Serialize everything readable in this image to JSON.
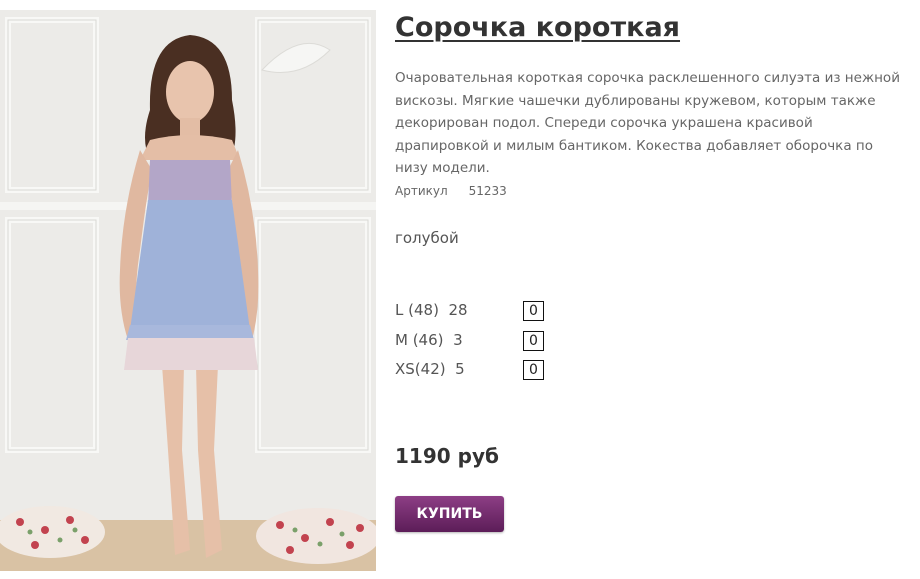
{
  "product": {
    "title": "Сорочка короткая",
    "description": "Очаровательная короткая сорочка расклешенного силуэта из нежной вискозы. Мягкие чашечки дублированы кружевом, которым также декорирован подол. Спереди сорочка украшена красивой драпировкой и милым бантиком. Кокества добавляет оборочка по низу модели.",
    "article_label": "Артикул",
    "article_value": "51233",
    "color": "голубой",
    "sizes": [
      {
        "label": "L (48)",
        "stock": "28",
        "qty": "0"
      },
      {
        "label": "M (46)",
        "stock": "3",
        "qty": "0"
      },
      {
        "label": "XS(42)",
        "stock": "5",
        "qty": "0"
      }
    ],
    "price": "1190 руб",
    "buy_label": "КУПИТЬ"
  },
  "colors": {
    "buy_button": "#6f2a6a",
    "dress": "#9fb2d9"
  }
}
